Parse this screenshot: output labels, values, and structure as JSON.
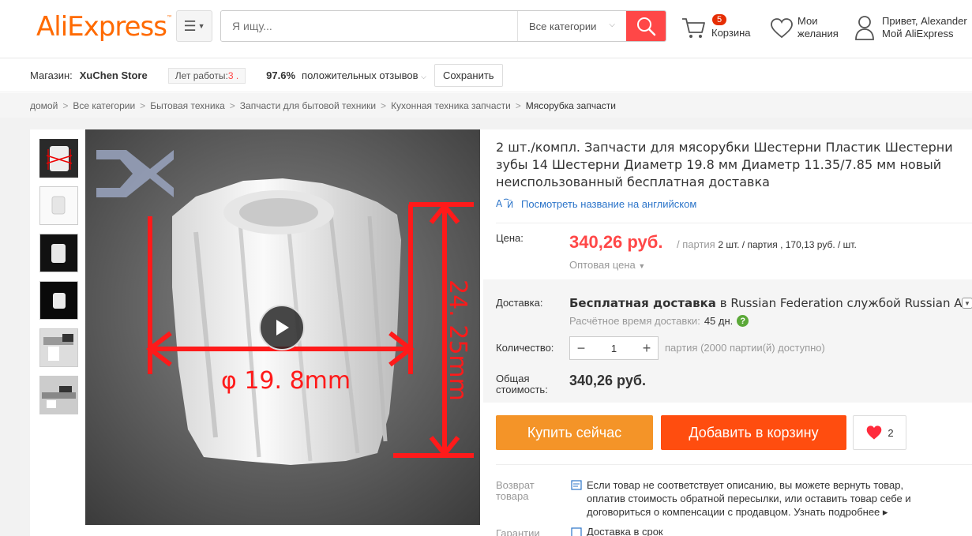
{
  "header": {
    "logo_text": "AliExpress",
    "logo_tm": "™",
    "search_placeholder": "Я ищу...",
    "category_select": "Все категории",
    "cart_count": "5",
    "cart_label": "Корзина",
    "wishlist_line1": "Мои",
    "wishlist_line2": "желания",
    "account_line1": "Привет, Alexander",
    "account_line2": "Мой AliExpress"
  },
  "store": {
    "store_label": "Магазин:",
    "store_name": "XuChen Store",
    "years_label": "Лет работы:",
    "years_value": "3 .",
    "feedback_pct": "97.6%",
    "feedback_label": "положительных отзывов",
    "save_label": "Сохранить"
  },
  "breadcrumb": [
    "домой",
    "Все категории",
    "Бытовая техника",
    "Запчасти для бытовой техники",
    "Кухонная техника запчасти",
    "Мясорубка запчасти"
  ],
  "breadcrumb_sep": ">",
  "gallery": {
    "dimension_vertical": "24. 25mm",
    "dimension_horizontal": "φ 19. 8mm"
  },
  "product": {
    "title": "2 шт./компл. Запчасти для мясорубки Шестерни Пластик Шестерни зубы 14 Шестерни Диаметр 19.8 мм Диаметр 11.35/7.85 мм новый неиспользованный бесплатная доставка",
    "translate_link": "Посмотреть название на английском",
    "price_label": "Цена:",
    "price": "340,26 руб.",
    "price_unit_prefix": "/ партия",
    "price_unit_detail": "2 шт. / партия , 170,13 руб. / шт.",
    "wholesale": "Оптовая цена",
    "shipping_label": "Доставка:",
    "shipping_free": "Бесплатная доставка",
    "shipping_in": "в",
    "shipping_dest": "Russian Federation",
    "shipping_by": "службой",
    "shipping_carrier": "Russian Air",
    "eta_label": "Расчётное время доставки:",
    "eta_value": "45 дн.",
    "qty_label": "Количество:",
    "qty_value": "1",
    "qty_available": "партия (2000 партии(й) доступно)",
    "total_label_1": "Общая",
    "total_label_2": "стоимость:",
    "total": "340,26 руб.",
    "buy_now": "Купить сейчас",
    "add_to_cart": "Добавить в корзину",
    "likes": "2",
    "return_label_1": "Возврат",
    "return_label_2": "товара",
    "return_text": "Если товар не соответствует описанию, вы можете вернуть товар, оплатив стоимость обратной пересылки, или оставить товар себе и договориться о компенсации с продавцом.",
    "return_more": "Узнать подробнее",
    "guarantee_label": "Гарантии",
    "guarantee_text": "Доставка в срок"
  },
  "colors": {
    "brand_orange": "#ff6a00",
    "price_red": "#ff4747",
    "buy_orange": "#f49428",
    "cart_red": "#ff4d0f",
    "link_blue": "#2b74c9"
  }
}
